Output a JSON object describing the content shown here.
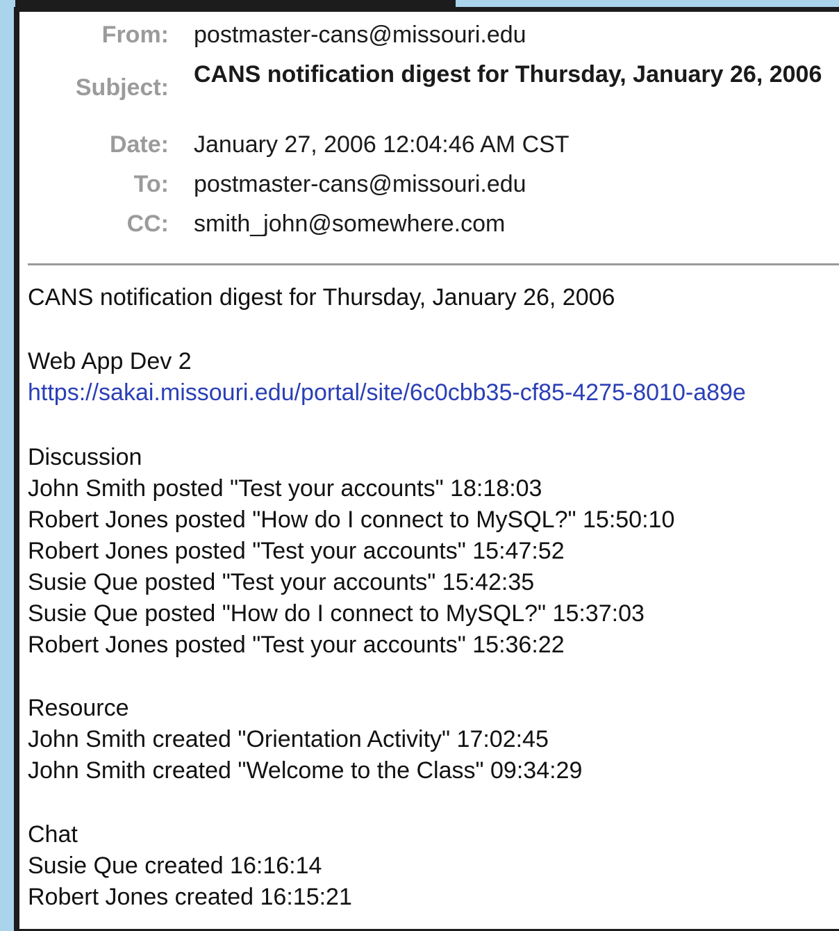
{
  "email": {
    "headers": {
      "from_label": "From:",
      "from": "postmaster-cans@missouri.edu",
      "subject_label": "Subject:",
      "subject": "CANS notification digest for Thursday, January 26, 2006",
      "date_label": "Date:",
      "date": "January 27, 2006 12:04:46 AM CST",
      "to_label": "To:",
      "to": "postmaster-cans@missouri.edu",
      "cc_label": "CC:",
      "cc": "smith_john@somewhere.com"
    },
    "body": {
      "title": "CANS notification digest for Thursday, January 26, 2006",
      "site_name": "Web App Dev 2",
      "site_url": "https://sakai.missouri.edu/portal/site/6c0cbb35-cf85-4275-8010-a89e",
      "sections": [
        {
          "heading": "Discussion",
          "items": [
            "John Smith posted \"Test your accounts\" 18:18:03",
            "Robert Jones posted \"How do I connect to MySQL?\" 15:50:10",
            "Robert Jones posted \"Test your accounts\" 15:47:52",
            "Susie Que posted \"Test your accounts\" 15:42:35",
            "Susie Que posted \"How do I connect to MySQL?\" 15:37:03",
            "Robert Jones posted \"Test your accounts\" 15:36:22"
          ]
        },
        {
          "heading": "Resource",
          "items": [
            "John Smith created \"Orientation Activity\" 17:02:45",
            "John Smith created \"Welcome to the Class\" 09:34:29"
          ]
        },
        {
          "heading": "Chat",
          "items": [
            "Susie Que created 16:16:14",
            "Robert Jones created 16:15:21"
          ]
        }
      ]
    }
  },
  "colors": {
    "page_background": "#a9d4ec",
    "frame": "#1c1c1c",
    "header_label": "#9b9b9b",
    "link": "#2a3fb5"
  }
}
